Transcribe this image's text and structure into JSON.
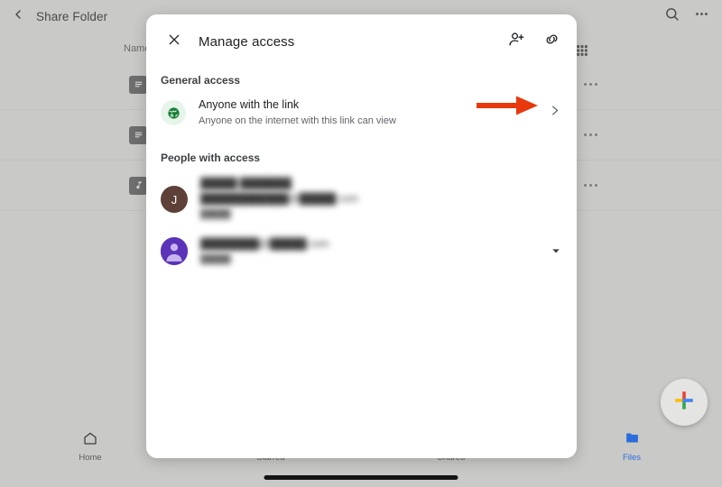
{
  "background": {
    "topbar": {
      "back_icon": "chevron-left-icon",
      "title": "Share Folder",
      "search_icon": "search-icon",
      "overflow_icon": "more-vertical-icon",
      "grid_icon": "grid-view-icon"
    },
    "column_header": "Name",
    "rows": [
      {
        "icon": "document-file-icon",
        "overflow_icon": "more-vertical-icon"
      },
      {
        "icon": "document-file-icon",
        "overflow_icon": "more-vertical-icon"
      },
      {
        "icon": "audio-file-icon",
        "overflow_icon": "more-vertical-icon"
      }
    ],
    "fab": {
      "icon": "plus-icon",
      "label": ""
    },
    "bottom_nav": [
      {
        "label": "Home",
        "icon": "home-icon",
        "active": false
      },
      {
        "label": "Starred",
        "icon": "star-icon",
        "active": false
      },
      {
        "label": "Shared",
        "icon": "shared-icon",
        "active": false
      },
      {
        "label": "Files",
        "icon": "folder-icon",
        "active": true
      }
    ]
  },
  "modal": {
    "close_icon": "close-icon",
    "title": "Manage access",
    "actions": [
      {
        "name": "add-person-icon",
        "label": "Add people"
      },
      {
        "name": "copy-link-icon",
        "label": "Copy link"
      }
    ],
    "general_access": {
      "section_label": "General access",
      "icon": "globe-icon",
      "title": "Anyone with the link",
      "subtitle": "Anyone on the internet with this link can view",
      "chevron_icon": "chevron-right-icon"
    },
    "people_with_access": {
      "section_label": "People with access",
      "people": [
        {
          "avatar_initial": "J",
          "avatar_color": "#5d4037",
          "avatar_type": "initial",
          "name": "█████ ███████",
          "email": "████████████@█████.com",
          "role": "█████",
          "redacted": true,
          "caret_icon": null
        },
        {
          "avatar_initial": "",
          "avatar_color": "#5b33b8",
          "avatar_type": "person-silhouette",
          "name": "",
          "email": "████████@█████.com",
          "role": "█████",
          "redacted": true,
          "caret_icon": "caret-down-icon"
        }
      ]
    }
  },
  "annotation": {
    "arrow": {
      "name": "red-pointer-arrow",
      "color": "#E8380D",
      "points_to": "general-access-chevron"
    }
  }
}
